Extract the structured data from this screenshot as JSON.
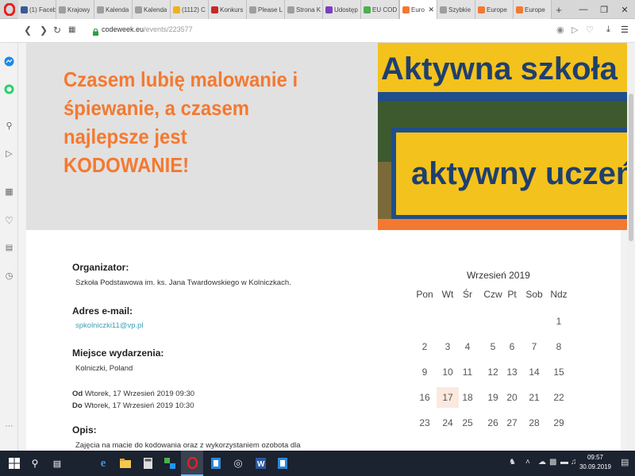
{
  "browser": {
    "tabs": [
      {
        "title": "(1) Faceb",
        "favicon": "facebook-icon",
        "color": "#3b5998"
      },
      {
        "title": "Krajowy",
        "favicon": "doc-icon",
        "color": "#9e9e9e"
      },
      {
        "title": "Kalenda",
        "favicon": "doc-icon",
        "color": "#9e9e9e"
      },
      {
        "title": "Kalenda",
        "favicon": "doc-icon",
        "color": "#9e9e9e"
      },
      {
        "title": "(1112) C",
        "favicon": "coin-icon",
        "color": "#f2b01e"
      },
      {
        "title": "Konkurs",
        "favicon": "badge-icon",
        "color": "#c62828"
      },
      {
        "title": "Please L",
        "favicon": "doc-icon",
        "color": "#9e9e9e"
      },
      {
        "title": "Strona K",
        "favicon": "doc-icon",
        "color": "#9e9e9e"
      },
      {
        "title": "Udostęp",
        "favicon": "share-icon",
        "color": "#7b3fbf"
      },
      {
        "title": "EU COD",
        "favicon": "star-icon",
        "color": "#4caf50"
      },
      {
        "title": "Euro",
        "favicon": "codeweek-icon",
        "color": "#f47930"
      },
      {
        "title": "Szybkie",
        "favicon": "grid-icon",
        "color": "#9e9e9e"
      },
      {
        "title": "Europe",
        "favicon": "codeweek-icon",
        "color": "#f47930"
      },
      {
        "title": "Europe",
        "favicon": "codeweek-icon",
        "color": "#f47930"
      }
    ],
    "url_host": "codeweek.eu",
    "url_path": "/events/223577"
  },
  "hero": {
    "title": "Czasem lubię malowanie i śpiewanie, a czasem najlepsze jest KODOWANIE!",
    "image_text_1": "Aktywna szkoła",
    "image_text_2": "aktywny uczeń"
  },
  "details": {
    "organizer_label": "Organizator:",
    "organizer_value": "Szkoła Podstawowa im. ks. Jana Twardowskiego w Kolniczkach.",
    "email_label": "Adres e-mail:",
    "email_value": "spkolniczki11@vp.pl",
    "location_label": "Miejsce wydarzenia:",
    "location_value": "Kolniczki, Poland",
    "from_label": "Od",
    "from_value": "Wtorek, 17 Wrzesień 2019 09:30",
    "to_label": "Do",
    "to_value": "Wtorek, 17 Wrzesień 2019 10:30",
    "desc_label": "Opis:",
    "desc_value": "Zajęcia na macie do kodowania oraz z wykorzystaniem ozobota dla"
  },
  "calendar": {
    "title": "Wrzesień 2019",
    "weekdays": [
      "Pon",
      "Wt",
      "Śr",
      "Czw",
      "Pt",
      "Sob",
      "Ndz"
    ],
    "weeks": [
      [
        "",
        "",
        "",
        "",
        "",
        "",
        "1"
      ],
      [
        "2",
        "3",
        "4",
        "5",
        "6",
        "7",
        "8"
      ],
      [
        "9",
        "10",
        "11",
        "12",
        "13",
        "14",
        "15"
      ],
      [
        "16",
        "17",
        "18",
        "19",
        "20",
        "21",
        "22"
      ],
      [
        "23",
        "24",
        "25",
        "26",
        "27",
        "28",
        "29"
      ]
    ],
    "highlighted_day": "17"
  },
  "taskbar": {
    "time": "09:57",
    "date": "30.09.2019"
  },
  "colors": {
    "accent_orange": "#f47930",
    "link_teal": "#40a0b8",
    "taskbar_bg": "#1b2230"
  }
}
